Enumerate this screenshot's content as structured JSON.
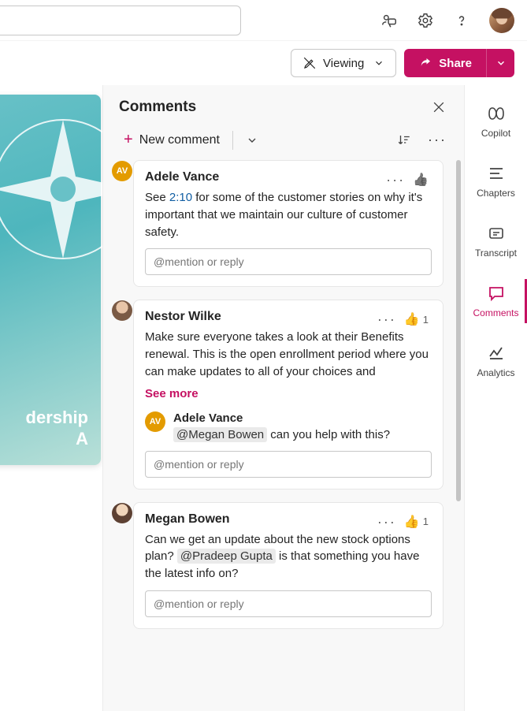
{
  "header": {
    "search_placeholder": "",
    "viewing_label": "Viewing",
    "share_label": "Share"
  },
  "comments_panel": {
    "title": "Comments",
    "new_comment_label": "New comment",
    "reply_placeholder": "@mention or reply"
  },
  "doc": {
    "title_line1": "dership",
    "title_line2": "A"
  },
  "rail": {
    "copilot": "Copilot",
    "chapters": "Chapters",
    "transcript": "Transcript",
    "comments": "Comments",
    "analytics": "Analytics"
  },
  "comments": [
    {
      "author": "Adele Vance",
      "avatar_initials": "AV",
      "avatar_class": "av-av",
      "body_pre": "See ",
      "timestamp_link": "2:10",
      "body_post": " for some of the customer stories on why it's important that we maintain our culture of customer safety.",
      "like_count": "",
      "like_grey": true
    },
    {
      "author": "Nestor Wilke",
      "avatar_initials": "",
      "avatar_class": "av-nw",
      "body": "Make sure everyone takes a look at their Benefits renewal. This is the open enrollment period where you can make updates to all of your choices and",
      "see_more": "See more",
      "like_count": "1",
      "like_grey": false,
      "reply": {
        "author": "Adele Vance",
        "avatar_initials": "AV",
        "avatar_class": "av-av",
        "mention": "@Megan Bowen",
        "text_post": " can you help with this?"
      }
    },
    {
      "author": "Megan Bowen",
      "avatar_initials": "",
      "avatar_class": "av-mb",
      "body_pre": "Can we get an update about the new stock options plan? ",
      "mention": "@Pradeep Gupta",
      "body_post": " is that something you have the latest info on?",
      "like_count": "1",
      "like_grey": false
    }
  ]
}
